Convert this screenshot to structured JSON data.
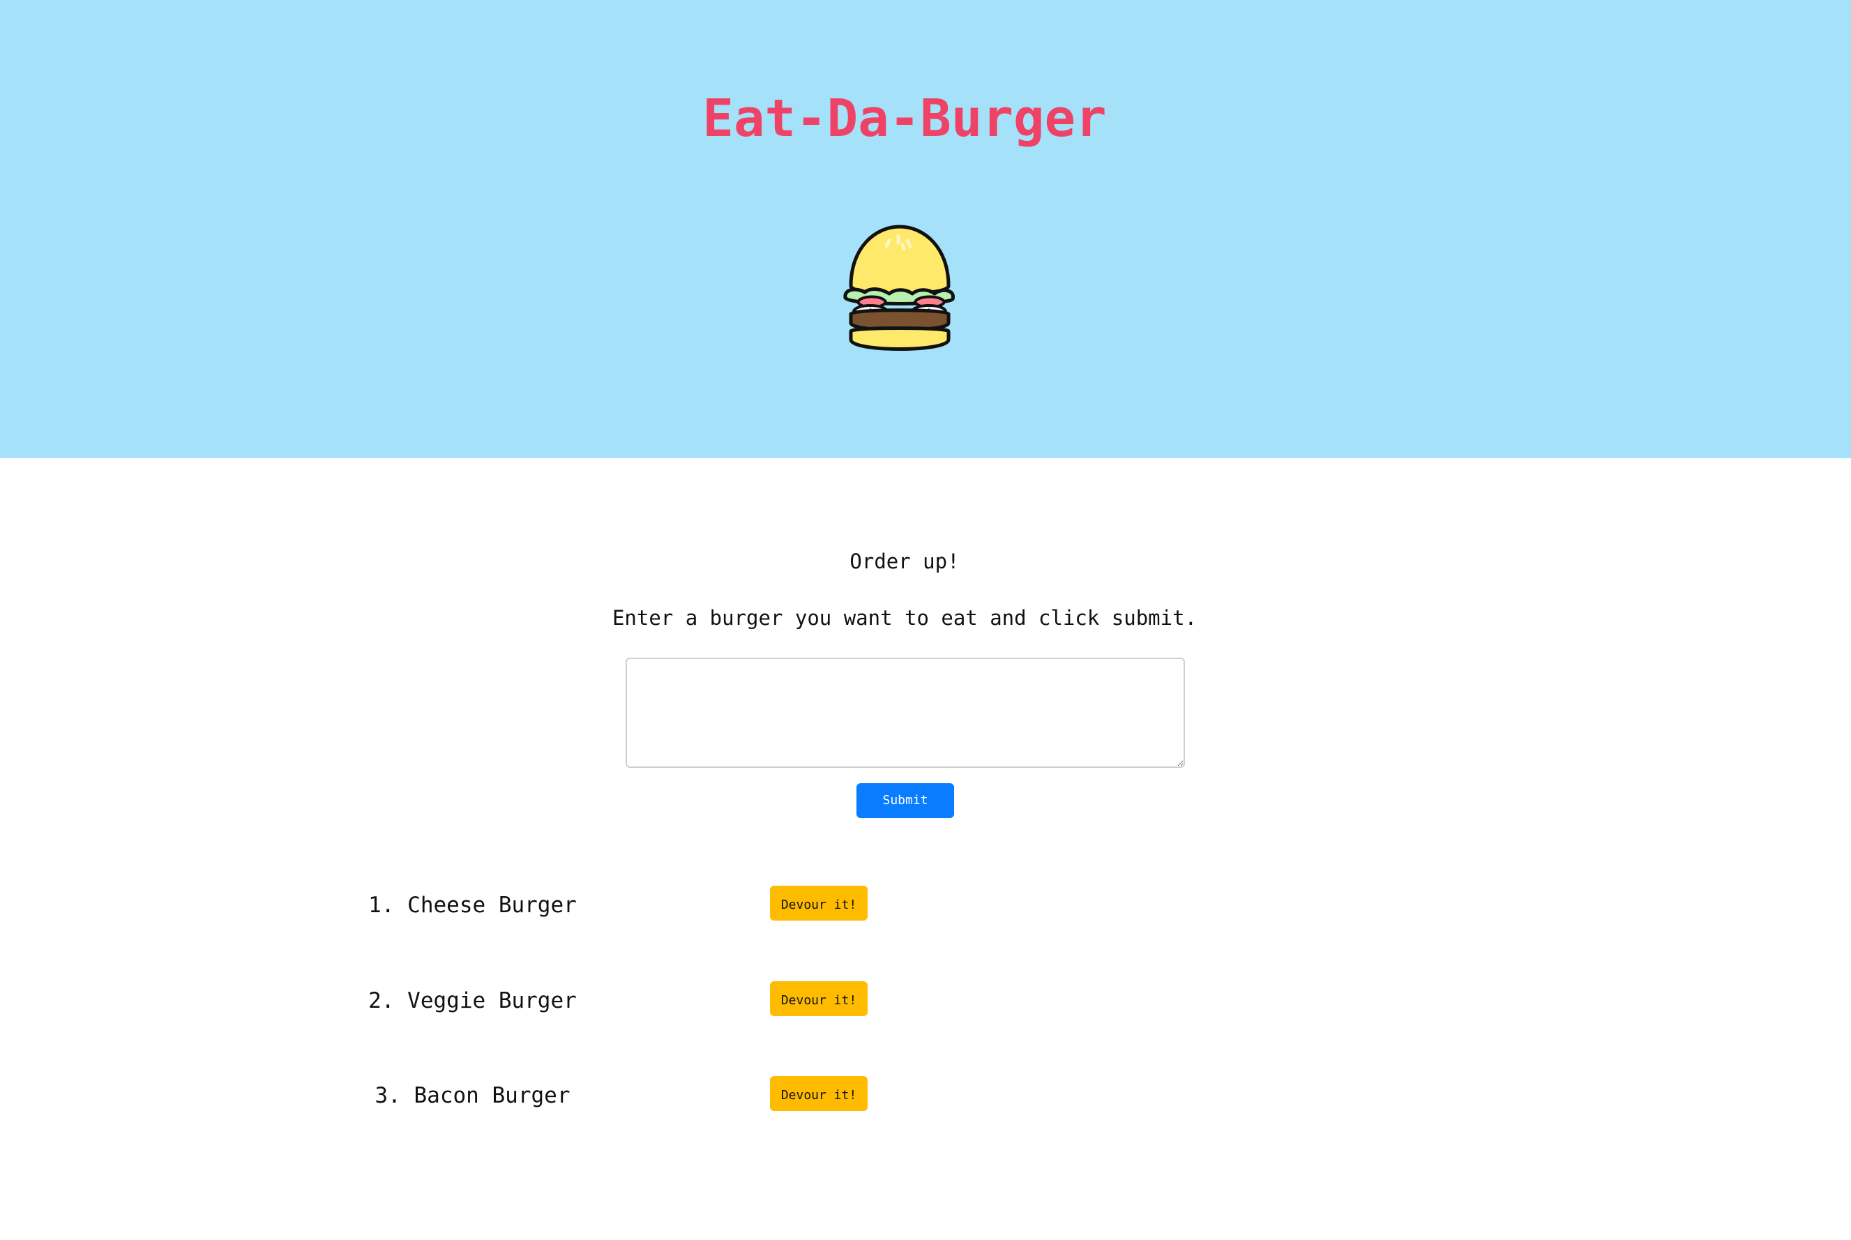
{
  "header": {
    "title": "Eat-Da-Burger",
    "logo_icon": "burger-icon"
  },
  "form": {
    "heading": "Order up!",
    "instructions": "Enter a burger you want to eat and click submit.",
    "input_value": "",
    "input_placeholder": "",
    "submit_label": "Submit"
  },
  "burgers": [
    {
      "number": "1.",
      "name": "Cheese Burger",
      "button_label": "Devour it!"
    },
    {
      "number": "2.",
      "name": "Veggie Burger",
      "button_label": "Devour it!"
    },
    {
      "number": "3.",
      "name": "Bacon Burger",
      "button_label": "Devour it!"
    }
  ],
  "colors": {
    "hero_background": "#a6e1fa",
    "title": "#ee4266",
    "submit_button": "#0a7cff",
    "devour_button": "#ffbb00"
  }
}
